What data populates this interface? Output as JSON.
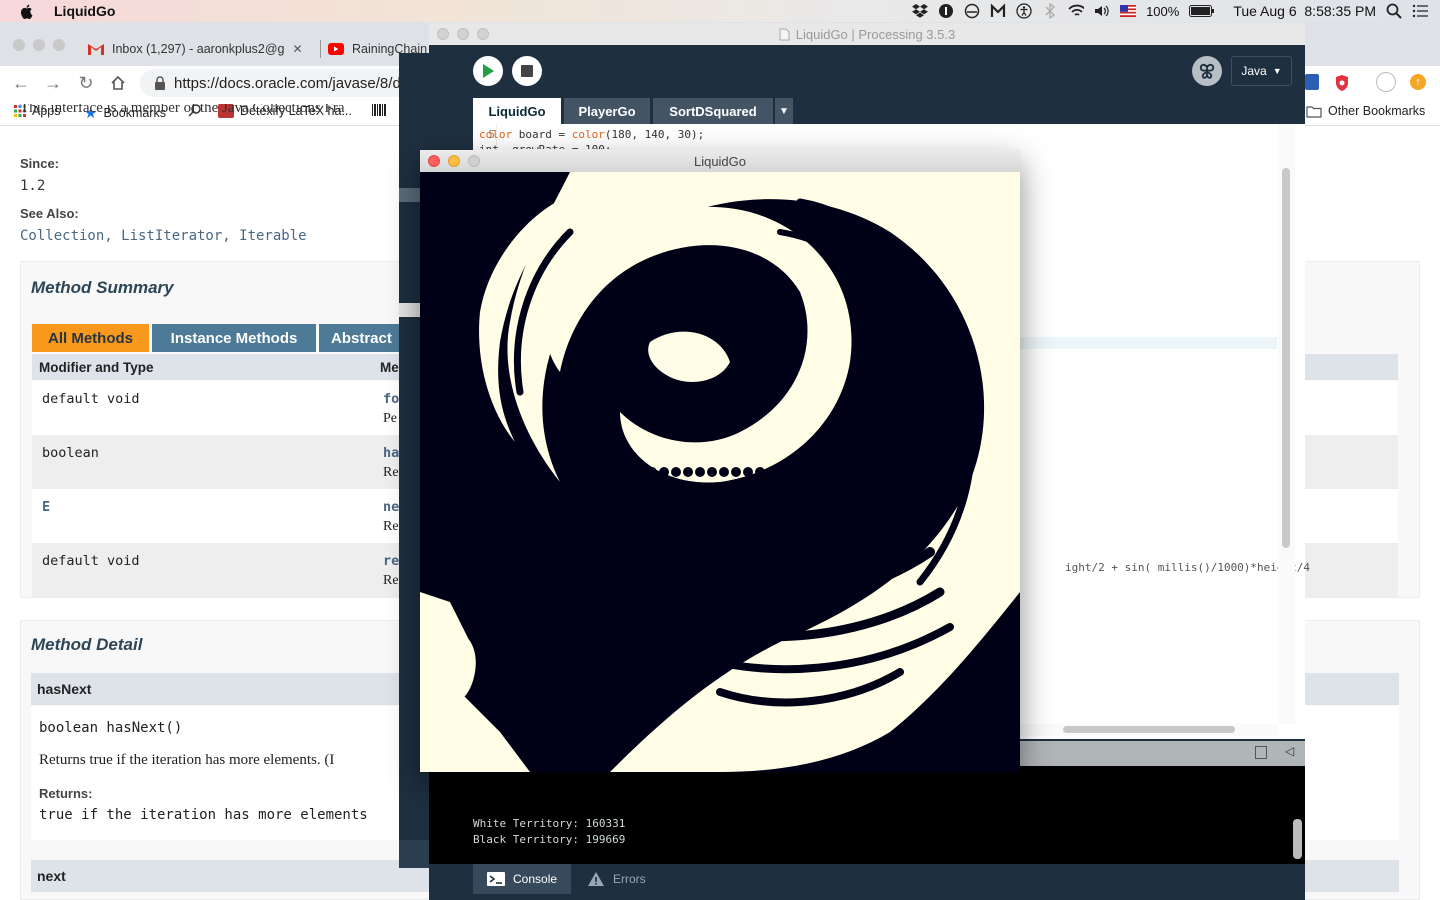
{
  "menubar": {
    "app_name": "LiquidGo",
    "battery": "100%",
    "clock": "Tue Aug 6  8:58:35 PM"
  },
  "browser": {
    "tabs": [
      {
        "label": "Inbox (1,297) - aaronkplus2@g",
        "icon": "gmail-icon"
      },
      {
        "label": "RainingChain",
        "icon": "youtube-icon"
      }
    ],
    "url": "https://docs.oracle.com/javase/8/d",
    "bookmarks": {
      "apps": "Apps",
      "bookmarks": "Bookmarks",
      "detexify": "Detexify LaTeX ha...",
      "other": "Other Bookmarks"
    }
  },
  "docs": {
    "cut_line": "This interface is a member of the Java Collections Fra",
    "since_label": "Since:",
    "since_value": "1.2",
    "see_also_label": "See Also:",
    "see_also_value": "Collection, ListIterator, Iterable",
    "method_summary_title": "Method Summary",
    "method_tabs": [
      "All Methods",
      "Instance Methods",
      "Abstract"
    ],
    "col_modifier": "Modifier and Type",
    "col_method": "Me",
    "rows": [
      {
        "type": "default void",
        "m1": "fo",
        "m2": "Pe"
      },
      {
        "type": "boolean",
        "m1": "ha",
        "m2": "Re"
      },
      {
        "type": "E",
        "m1": "ne",
        "m2": "Re"
      },
      {
        "type": "default void",
        "m1": "re",
        "m2": "Re"
      }
    ],
    "method_detail_title": "Method Detail",
    "detail_name": "hasNext",
    "detail_sig": "boolean hasNext()",
    "detail_desc": "Returns true if the iteration has more elements. (I",
    "returns_label": "Returns:",
    "returns_value": "true if the iteration has more elements",
    "next_name": "next"
  },
  "ide": {
    "title": "LiquidGo | Processing 3.5.3",
    "mode": "Java",
    "tabs": [
      "LiquidGo",
      "PlayerGo",
      "SortDSquared"
    ],
    "line_number": "5",
    "code_line": "color board = color(180, 140, 30);",
    "code_line_cut": "int  growRate = 100;",
    "code_fragment": "ight/2 + sin( millis()/1000)*height/4",
    "console_lines": [
      "White Territory: 160331",
      "Black Territory: 199669"
    ],
    "console_tab": "Console",
    "errors_tab": "Errors"
  },
  "sketch": {
    "title": "LiquidGo",
    "colors": {
      "light": "#fffde6",
      "dark": "#000016"
    }
  }
}
